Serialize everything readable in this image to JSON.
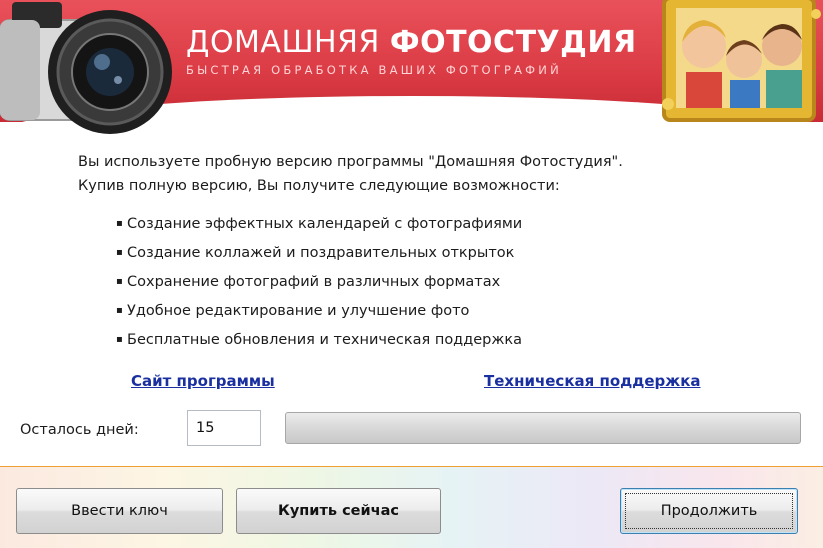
{
  "header": {
    "title_thin": "ДОМАШНЯЯ ",
    "title_bold": "ФОТОСТУДИЯ",
    "subtitle": "БЫСТРАЯ ОБРАБОТКА ВАШИХ ФОТОГРАФИЙ",
    "accent_color": "#dc3d46"
  },
  "intro": {
    "line1": "Вы используете пробную версию программы \"Домашняя Фотостудия\".",
    "line2": "Купив полную версию, Вы получите следующие возможности:"
  },
  "features": [
    "Создание эффектных календарей с фотографиями",
    "Создание коллажей и поздравительных открыток",
    "Сохранение фотографий в различных форматах",
    "Удобное редактирование и улучшение фото",
    "Бесплатные обновления и техническая поддержка"
  ],
  "links": {
    "site": "Сайт программы",
    "support": "Техническая поддержка"
  },
  "trial": {
    "days_label": "Осталось дней:",
    "days_value": "15",
    "progress_fraction": 0
  },
  "buttons": {
    "enter_key": "Ввести ключ",
    "buy_now": "Купить сейчас",
    "continue": "Продолжить"
  },
  "icons": {
    "bullet": "▪"
  }
}
